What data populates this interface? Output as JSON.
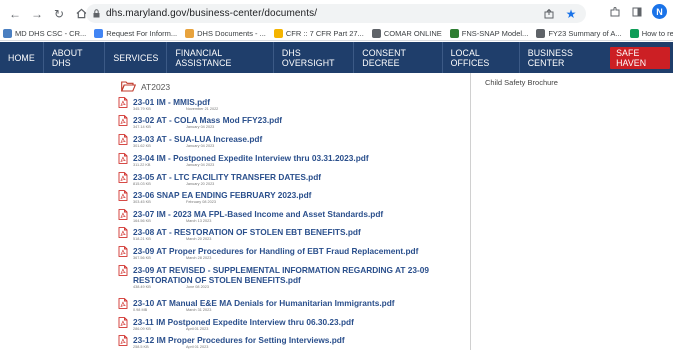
{
  "browser": {
    "url": "dhs.maryland.gov/business-center/documents/",
    "profile_initial": "N",
    "bookmarks": [
      {
        "label": "MD DHS CSC - CR...",
        "color": "#4a7fc1"
      },
      {
        "label": "Request For Inform...",
        "color": "#4285f4"
      },
      {
        "label": "DHS Documents - ...",
        "color": "#e8a33d"
      },
      {
        "label": "CFR :: 7 CFR Part 27...",
        "color": "#f4b400"
      },
      {
        "label": "COMAR ONLINE",
        "color": "#5f6368"
      },
      {
        "label": "FNS-SNAP Model...",
        "color": "#2e7d32"
      },
      {
        "label": "FY23 Summary of A...",
        "color": "#5f6368"
      },
      {
        "label": "How to remove a li...",
        "color": "#0f9d58"
      }
    ]
  },
  "nav": {
    "items": [
      "HOME",
      "ABOUT DHS",
      "SERVICES",
      "FINANCIAL ASSISTANCE",
      "DHS OVERSIGHT",
      "CONSENT DECREE",
      "LOCAL OFFICES",
      "BUSINESS CENTER"
    ],
    "safe_haven": "SAFE HAVEN"
  },
  "sidebar": {
    "link": "Child Safety Brochure"
  },
  "folder": {
    "label": "AT2023"
  },
  "documents": [
    {
      "title": "23-01 IM - MMIS.pdf",
      "size": "345.79 KB",
      "date": "November 21 2022"
    },
    {
      "title": "23-02 AT - COLA Mass Mod FFY23.pdf",
      "size": "347.14 KB",
      "date": "January 04 2023"
    },
    {
      "title": "23-03 AT - SUA-LUA Increase.pdf",
      "size": "301.62 KB",
      "date": "January 04 2023"
    },
    {
      "title": "23-04 IM - Postponed Expedite Interview thru 03.31.2023.pdf",
      "size": "311.22 KB",
      "date": "January 04 2023"
    },
    {
      "title": "23-05 AT - LTC FACILITY TRANSFER DATES.pdf",
      "size": "815.03 KB",
      "date": "January 20 2023"
    },
    {
      "title": "23-06 SNAP EA ENDING FEBRUARY 2023.pdf",
      "size": "303.45 KB",
      "date": "February 08 2023"
    },
    {
      "title": "23-07 IM - 2023 MA FPL-Based Income and Asset Standards.pdf",
      "size": "164.56 KB",
      "date": "March 13 2023"
    },
    {
      "title": "23-08 AT - RESTORATION OF STOLEN EBT BENEFITS.pdf",
      "size": "518.21 KB",
      "date": "March 20 2023"
    },
    {
      "title": "23-09 AT Proper Procedures for Handling of EBT Fraud Replacement.pdf",
      "size": "367.56 KB",
      "date": "March 28 2023"
    },
    {
      "title": "23-09 AT REVISED - SUPPLEMENTAL INFORMATION REGARDING AT 23-09 RESTORATION OF STOLEN BENEFITS.pdf",
      "size": "438.49 KB",
      "date": "June 08 2023"
    },
    {
      "title": "23-10 AT Manual E&E MA Denials for Humanitarian Immigrants.pdf",
      "size": "0.98 MB",
      "date": "March 31 2023"
    },
    {
      "title": "23-11 IM Postponed Expedite Interview thru 06.30.23.pdf",
      "size": "286.09 KB",
      "date": "April 01 2023"
    },
    {
      "title": "23-12 IM Proper Procedures for Setting Interviews.pdf",
      "size": "258.5 KB",
      "date": "April 01 2023"
    }
  ]
}
